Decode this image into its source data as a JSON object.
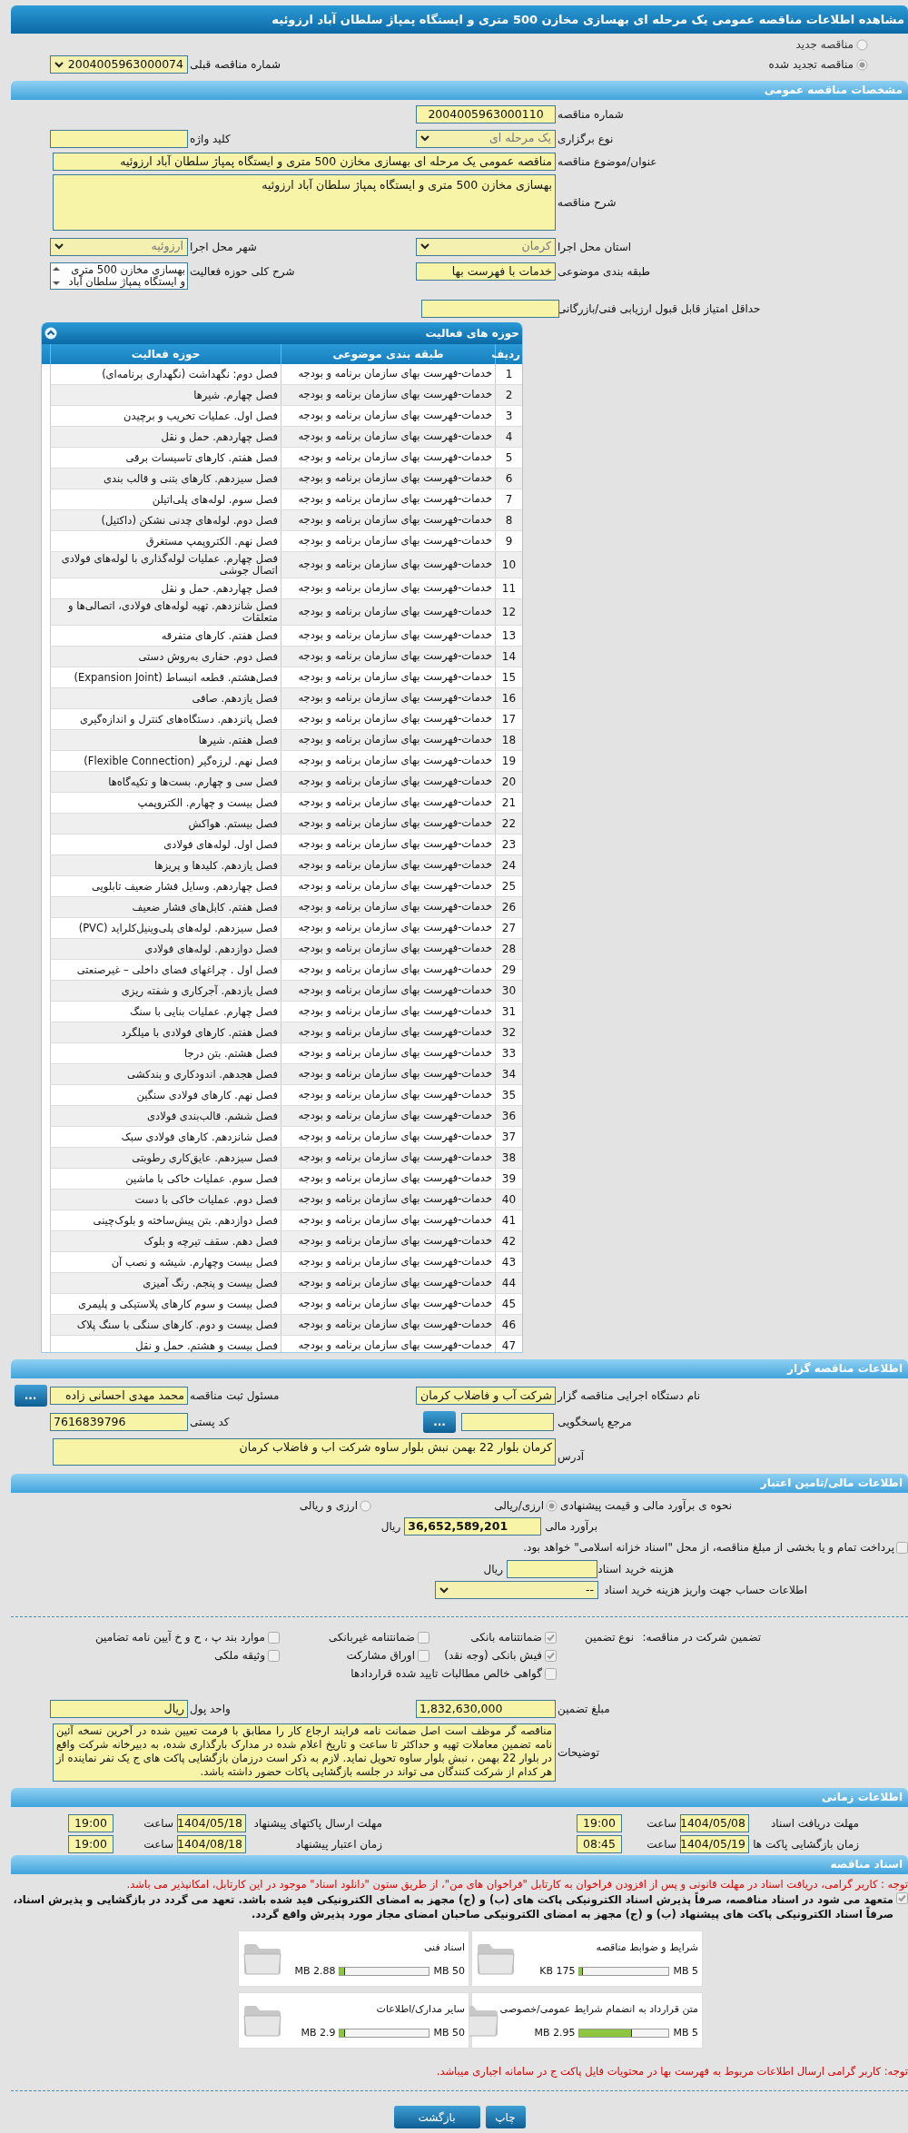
{
  "page_title": "مشاهده اطلاعات مناقصه عمومی یک مرحله ای بهسازی مخازن 500 متری و ایستگاه پمپاژ سلطان آباد ارزوئیه",
  "tender_status": [
    {
      "label": "مناقصه جدید",
      "selected": false
    },
    {
      "label": "مناقصه تجدید شده",
      "selected": true
    }
  ],
  "previous_tender": {
    "label": "شماره مناقصه قبلی",
    "value": "2004005963000074"
  },
  "general": {
    "title": "مشخصات مناقصه عمومی",
    "tender_number": {
      "label": "شماره مناقصه",
      "value": "2004005963000110"
    },
    "keyword": {
      "label": "کلید واژه"
    },
    "holding_type": {
      "label": "نوع برگزاری",
      "value": "یک مرحله ای"
    },
    "subject": {
      "label": "عنوان/موضوع مناقصه",
      "value": "مناقصه عمومی یک مرحله ای بهسازی مخازن 500 متری و ایستگاه پمپاژ سلطان آباد ارزوئیه"
    },
    "description": {
      "label": "شرح مناقصه",
      "value": "بهسازی مخازن 500 متری و ایستگاه پمپاژ سلطان آباد ارزوئیه"
    },
    "province": {
      "label": "استان محل اجرا",
      "value": "کرمان"
    },
    "city": {
      "label": "شهر محل اجرا",
      "value": "ارزوئیه"
    },
    "category": {
      "label": "طبقه بندی موضوعی",
      "value": "خدمات با فهرست بها"
    },
    "activity_summary": {
      "label": "شرح کلی حوزه فعالیت",
      "value": "بهسازی مخازن 500 متری و ایستگاه پمپاژ سلطان آباد"
    },
    "min_score": {
      "label": "حداقل امتیاز قابل قبول ارزیابی فنی/بازرگانی"
    }
  },
  "activities": {
    "title": "حوزه های فعالیت",
    "columns": [
      "ردیف",
      "طبقه بندی موضوعی",
      "حوزه فعالیت"
    ],
    "rows": [
      {
        "no": "1",
        "category": "خدمات-فهرست بهای سازمان برنامه و بودجه",
        "activity": "فصل دوم: نگهداشت (نگهداری برنامه‌ای)"
      },
      {
        "no": "2",
        "category": "خدمات-فهرست بهای سازمان برنامه و بودجه",
        "activity": "فصل چهارم. شیرها"
      },
      {
        "no": "3",
        "category": "خدمات-فهرست بهای سازمان برنامه و بودجه",
        "activity": "فصل اول. عملیات تخریب و برچیدن"
      },
      {
        "no": "4",
        "category": "خدمات-فهرست بهای سازمان برنامه و بودجه",
        "activity": "فصل چهاردهم. حمل و نقل"
      },
      {
        "no": "5",
        "category": "خدمات-فهرست بهای سازمان برنامه و بودجه",
        "activity": "فصل هفتم. کارهای تاسیسات برقی"
      },
      {
        "no": "6",
        "category": "خدمات-فهرست بهای سازمان برنامه و بودجه",
        "activity": "فصل سیزدهم. کارهای بتنی و قالب بندی"
      },
      {
        "no": "7",
        "category": "خدمات-فهرست بهای سازمان برنامه و بودجه",
        "activity": "فصل سوم. لوله‌های پلی‌اتیلن"
      },
      {
        "no": "8",
        "category": "خدمات-فهرست بهای سازمان برنامه و بودجه",
        "activity": "فصل دوم. لوله‌های چدنی نشکن (داکتیل)"
      },
      {
        "no": "9",
        "category": "خدمات-فهرست بهای سازمان برنامه و بودجه",
        "activity": "فصل نهم. الکتروپمپ مستغرق"
      },
      {
        "no": "10",
        "category": "خدمات-فهرست بهای سازمان برنامه و بودجه",
        "activity": "فصل چهارم. عملیات لوله‌گذاری با لوله‌های فولادی اتصال جوشی"
      },
      {
        "no": "11",
        "category": "خدمات-فهرست بهای سازمان برنامه و بودجه",
        "activity": "فصل چهاردهم. حمل و نقل"
      },
      {
        "no": "12",
        "category": "خدمات-فهرست بهای سازمان برنامه و بودجه",
        "activity": "فصل شانزدهم. تهیه لوله‌های فولادی، اتصالی‌ها و متعلقات"
      },
      {
        "no": "13",
        "category": "خدمات-فهرست بهای سازمان برنامه و بودجه",
        "activity": "فصل هفتم. کارهای متفرقه"
      },
      {
        "no": "14",
        "category": "خدمات-فهرست بهای سازمان برنامه و بودجه",
        "activity": "فصل دوم. حفاری به‌روش دستی"
      },
      {
        "no": "15",
        "category": "خدمات-فهرست بهای سازمان برنامه و بودجه",
        "activity": "فصل‌هشتم. قطعه انبساط (Expansion Joint)"
      },
      {
        "no": "16",
        "category": "خدمات-فهرست بهای سازمان برنامه و بودجه",
        "activity": "فصل یازدهم. صافی"
      },
      {
        "no": "17",
        "category": "خدمات-فهرست بهای سازمان برنامه و بودجه",
        "activity": "فصل پانزدهم. دستگاه‌های کنترل و اندازه‌گیری"
      },
      {
        "no": "18",
        "category": "خدمات-فهرست بهای سازمان برنامه و بودجه",
        "activity": "فصل هفتم. شیرها"
      },
      {
        "no": "19",
        "category": "خدمات-فهرست بهای سازمان برنامه و بودجه",
        "activity": "فصل نهم. لرزه‌گیر (Flexible Connection)"
      },
      {
        "no": "20",
        "category": "خدمات-فهرست بهای سازمان برنامه و بودجه",
        "activity": "فصل سی و چهارم. بست‌ها و تکیه‌گاه‌ها"
      },
      {
        "no": "21",
        "category": "خدمات-فهرست بهای سازمان برنامه و بودجه",
        "activity": "فصل بیست و چهارم. الکتروپمپ"
      },
      {
        "no": "22",
        "category": "خدمات-فهرست بهای سازمان برنامه و بودجه",
        "activity": "فصل بیستم. هواکش"
      },
      {
        "no": "23",
        "category": "خدمات-فهرست بهای سازمان برنامه و بودجه",
        "activity": "فصل اول. لوله‌های فولادی"
      },
      {
        "no": "24",
        "category": "خدمات-فهرست بهای سازمان برنامه و بودجه",
        "activity": "فصل یازدهم. کلیدها و پریزها"
      },
      {
        "no": "25",
        "category": "خدمات-فهرست بهای سازمان برنامه و بودجه",
        "activity": "فصل چهاردهم. وسایل فشار ضعیف تابلویی"
      },
      {
        "no": "26",
        "category": "خدمات-فهرست بهای سازمان برنامه و بودجه",
        "activity": "فصل هفتم. کابل‌های فشار ضعیف"
      },
      {
        "no": "27",
        "category": "خدمات-فهرست بهای سازمان برنامه و بودجه",
        "activity": "فصل سیزدهم. لوله‌های پلی‌وینیل‌کلراید (PVC)"
      },
      {
        "no": "28",
        "category": "خدمات-فهرست بهای سازمان برنامه و بودجه",
        "activity": "فصل دوازدهم. لوله‌های فولادی"
      },
      {
        "no": "29",
        "category": "خدمات-فهرست بهای سازمان برنامه و بودجه",
        "activity": "فصل اول . چراغهای فضای داخلی – غیرصنعتی"
      },
      {
        "no": "30",
        "category": "خدمات-فهرست بهای سازمان برنامه و بودجه",
        "activity": "فصل یازدهم. آجرکاری و شفته ریزی"
      },
      {
        "no": "31",
        "category": "خدمات-فهرست بهای سازمان برنامه و بودجه",
        "activity": "فصل چهارم. عملیات بنایی با سنگ"
      },
      {
        "no": "32",
        "category": "خدمات-فهرست بهای سازمان برنامه و بودجه",
        "activity": "فصل هفتم. کارهای فولادی با میلگرد"
      },
      {
        "no": "33",
        "category": "خدمات-فهرست بهای سازمان برنامه و بودجه",
        "activity": "فصل هشتم. بتن درجا"
      },
      {
        "no": "34",
        "category": "خدمات-فهرست بهای سازمان برنامه و بودجه",
        "activity": "فصل هجدهم. اندودکاری و بندکشی"
      },
      {
        "no": "35",
        "category": "خدمات-فهرست بهای سازمان برنامه و بودجه",
        "activity": "فصل نهم. کارهای فولادی سنگین"
      },
      {
        "no": "36",
        "category": "خدمات-فهرست بهای سازمان برنامه و بودجه",
        "activity": "فصل ششم. قالب‌بندی فولادی"
      },
      {
        "no": "37",
        "category": "خدمات-فهرست بهای سازمان برنامه و بودجه",
        "activity": "فصل شانزدهم. کارهای فولادی سبک"
      },
      {
        "no": "38",
        "category": "خدمات-فهرست بهای سازمان برنامه و بودجه",
        "activity": "فصل سیزدهم. عایق‌کاری رطوبتی"
      },
      {
        "no": "39",
        "category": "خدمات-فهرست بهای سازمان برنامه و بودجه",
        "activity": "فصل سوم. عملیات خاکی با ماشین"
      },
      {
        "no": "40",
        "category": "خدمات-فهرست بهای سازمان برنامه و بودجه",
        "activity": "فصل دوم. عملیات خاکی با دست"
      },
      {
        "no": "41",
        "category": "خدمات-فهرست بهای سازمان برنامه و بودجه",
        "activity": "فصل دوازدهم. بتن پیش‌ساخته و بلوک‌چینی"
      },
      {
        "no": "42",
        "category": "خدمات-فهرست بهای سازمان برنامه و بودجه",
        "activity": "فصل دهم. سقف تیرچه و بلوک"
      },
      {
        "no": "43",
        "category": "خدمات-فهرست بهای سازمان برنامه و بودجه",
        "activity": "فصل بیست وچهارم. شیشه و نصب آن"
      },
      {
        "no": "44",
        "category": "خدمات-فهرست بهای سازمان برنامه و بودجه",
        "activity": "فصل بیست و پنجم. رنگ آمیزی"
      },
      {
        "no": "45",
        "category": "خدمات-فهرست بهای سازمان برنامه و بودجه",
        "activity": "فصل بیست و سوم کارهای پلاستیکی و پلیمری"
      },
      {
        "no": "46",
        "category": "خدمات-فهرست بهای سازمان برنامه و بودجه",
        "activity": "فصل بیست و دوم. کارهای سنگی با سنگ پلاک"
      },
      {
        "no": "47",
        "category": "خدمات-فهرست بهای سازمان برنامه و بودجه",
        "activity": "فصل بیست و هشتم. حمل و نقل"
      }
    ]
  },
  "tenderer": {
    "title": "اطلاعات مناقصه گزار",
    "organization": {
      "label": "نام دستگاه اجرایی مناقصه گزار",
      "value": "شرکت آب و فاضلاب کرمان"
    },
    "registrar": {
      "label": "مسئول ثبت مناقصه",
      "value": "محمد مهدی احسانی زاده",
      "button": "..."
    },
    "reference": {
      "label": "مرجع پاسخگویی",
      "button": "..."
    },
    "postal_code": {
      "label": "کد پستی",
      "value": "7616839796"
    },
    "address": {
      "label": "آدرس",
      "value": "کرمان بلوار 22 بهمن نبش بلوار ساوه شرکت اب و فاضلاب کرمان"
    }
  },
  "finance": {
    "title": "اطلاعات مالی/تامین اعتبار",
    "method": {
      "label": "نحوه ی برآورد مالی و قیمت پیشنهادی",
      "options": [
        {
          "label": "ارزی/ریالی",
          "selected": true
        },
        {
          "label": "ارزی و ریالی",
          "selected": false
        }
      ]
    },
    "estimate": {
      "label": "برآورد مالی",
      "value": "36,652,589,201",
      "unit": "ریال"
    },
    "treasury": {
      "label": "پرداخت تمام و یا بخشی از مبلغ مناقصه، از محل \"اسناد خزانه اسلامی\" خواهد بود.",
      "checked": false
    },
    "document_fee": {
      "label": "هزینه خرید اسناد",
      "unit": "ریال"
    },
    "fee_account": {
      "label": "اطلاعات حساب جهت واریز هزینه خرید اسناد",
      "value": "--"
    },
    "guarantee": {
      "label": "تضمین شرکت در مناقصه:",
      "type_label": "نوع تضمین",
      "options": [
        {
          "label": "ضمانتنامه بانکی",
          "checked": true
        },
        {
          "label": "ضمانتنامه غیربانکی",
          "checked": false
        },
        {
          "label": "موارد بند پ ، ح و خ آیین نامه تضامین",
          "checked": false
        },
        {
          "label": "فیش بانکی (وجه نقد)",
          "checked": true
        },
        {
          "label": "اوراق مشارکت",
          "checked": false
        },
        {
          "label": "وثیقه ملکی",
          "checked": false
        },
        {
          "label": "گواهی خالص مطالبات تایید شده قراردادها",
          "checked": false
        }
      ]
    },
    "guarantee_amount": {
      "label": "مبلغ تضمین",
      "value": "1,832,630,000"
    },
    "currency": {
      "label": "واحد پول",
      "value": "ریال"
    },
    "notes": {
      "label": "توضیحات",
      "value": "مناقصه گر موظف است اصل ضمانت نامه فرایند ارجاع کار را مطابق با فرمت تعیین شده در آخرین نسخه آئین نامه تضمین معاملات  تهیه و حداکثر تا ساعت و تاریخ اعلام شده در مدارک بارگذاری شده،  به  دبیرخانه شرکت واقع در بلوار 22 بهمن ، نبش بلوار ساوه تحویل نماید. لازم به ذکر است   درزمان   بازگشایی پاکت های  ج  یک نفر نماینده از هر کدام از شرکت کنندگان  می تواند  در جلسه بازگشایی پاکات حضور داشته باشد."
    }
  },
  "timing": {
    "title": "اطلاعات زمانی",
    "items": [
      {
        "label": "مهلت دریافت اسناد",
        "date": "1404/05/08",
        "time_label": "ساعت",
        "time": "19:00"
      },
      {
        "label": "مهلت ارسال پاکتهای پیشنهاد",
        "date": "1404/05/18",
        "time_label": "ساعت",
        "time": "19:00"
      },
      {
        "label": "زمان بازگشایی پاکت ها",
        "date": "1404/05/19",
        "time_label": "ساعت",
        "time": "08:45"
      },
      {
        "label": "زمان اعتبار پیشنهاد",
        "date": "1404/08/18",
        "time_label": "ساعت",
        "time": "19:00"
      }
    ]
  },
  "documents": {
    "title": "اسناد مناقصه",
    "notice": "توجه : کاربر گرامی، دریافت اسناد در مهلت قانونی و پس از افزودن فراخوان به کارتابل \"فراخوان های من\"، از طریق ستون \"دانلود اسناد\" موجود در این کارتابل، امکانپذیر می باشد.",
    "pledge": {
      "text": "متعهد می شود در اسناد مناقصه، صرفاً پذیرش اسناد الکترونیکی پاکت های (ب) و (ج) مجهز به امضای الکترونیکی قید شده باشد. تعهد می گردد در بازگشایی و پذیرش اسناد، صرفاً اسناد الکترونیکی پاکت های پیشنهاد (ب) و (ج) مجهز به امضای الکترونیکی صاحبان امضای مجاز مورد پذیرش واقع گردد.",
      "checked": true
    },
    "files": [
      {
        "name": "شرایط و ضوابط مناقصه",
        "size": "175 KB",
        "max": "5 MB",
        "level": 0.034
      },
      {
        "name": "اسناد فنی",
        "size": "2.88 MB",
        "max": "50 MB",
        "level": 0.058
      },
      {
        "name": "متن قرارداد به انضمام شرایط عمومی/خصوصی",
        "size": "2.95 MB",
        "max": "5 MB",
        "level": 0.59
      },
      {
        "name": "سایر مدارک/اطلاعات",
        "size": "2.9 MB",
        "max": "50 MB",
        "level": 0.058
      }
    ],
    "footer_notice": "توجه: کاربر گرامی ارسال اطلاعات مربوط به فهرست بها در محتویات فایل پاکت ج در سامانه اجباری میباشد."
  },
  "buttons": [
    {
      "label": "چاپ"
    },
    {
      "label": "بازگشت"
    }
  ]
}
